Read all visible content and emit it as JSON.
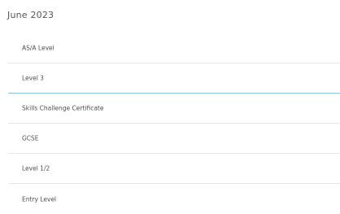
{
  "page": {
    "title": "June 2023"
  },
  "qualifications": [
    {
      "label": "AS/A Level"
    },
    {
      "label": "Level 3"
    },
    {
      "label": "Skills Challenge Certificate"
    },
    {
      "label": "GCSE"
    },
    {
      "label": "Level 1/2"
    },
    {
      "label": "Entry Level"
    }
  ],
  "colors": {
    "divider": "#e4e7ec",
    "active_divider": "#8ec2e3",
    "text": "#4f4f4f"
  }
}
